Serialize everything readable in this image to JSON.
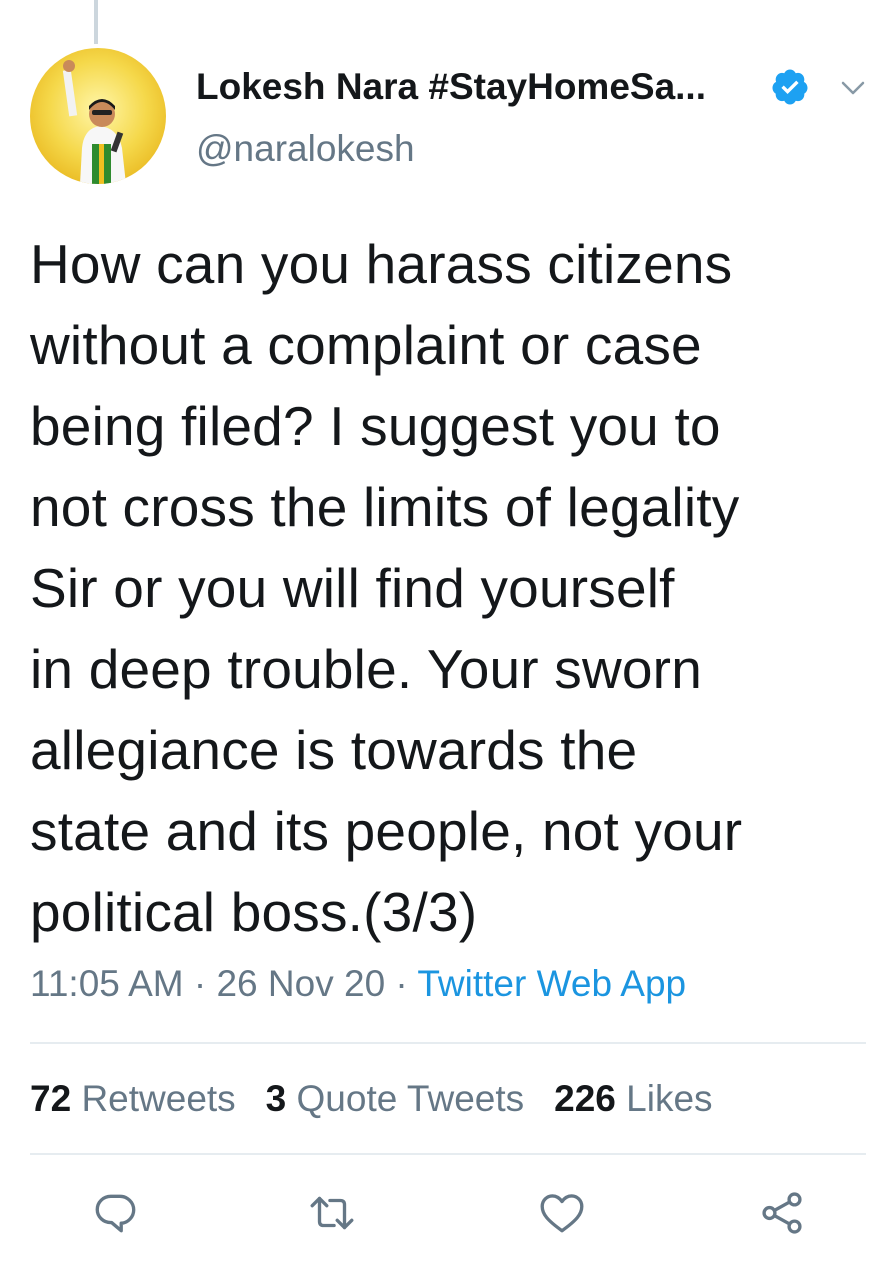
{
  "tweet": {
    "display_name": "Lokesh Nara #StayHomeSa...",
    "handle": "@naralokesh",
    "text": "How can you harass citizens\nwithout a complaint or case\nbeing filed? I suggest you to\nnot cross the limits of legality\nSir or you will find yourself\nin deep trouble. Your sworn\nallegiance is towards the\nstate and its people, not your\npolitical boss.(3/3)",
    "time": "11:05 AM",
    "separator": " · ",
    "date": "26 Nov 20",
    "source": "Twitter Web App"
  },
  "stats": {
    "retweets_count": "72",
    "retweets_label": "Retweets",
    "quotes_count": "3",
    "quotes_label": "Quote Tweets",
    "likes_count": "226",
    "likes_label": "Likes"
  },
  "icons": {
    "verified": "verified-badge-icon",
    "menu": "chevron-down-icon",
    "reply": "reply-icon",
    "retweet": "retweet-icon",
    "like": "heart-icon",
    "share": "share-icon"
  },
  "colors": {
    "text": "#14171a",
    "secondary": "#657786",
    "link": "#1b95e0",
    "verified": "#1da1f2",
    "divider": "#e6ecf0"
  }
}
